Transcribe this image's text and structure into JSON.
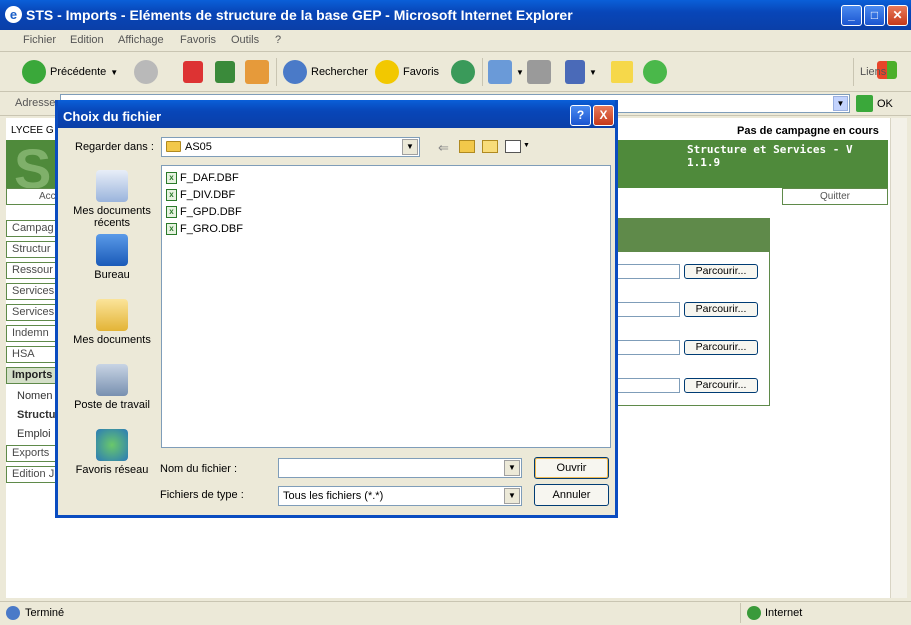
{
  "window": {
    "title": "STS - Imports - Eléments de structure de la base GEP - Microsoft Internet Explorer"
  },
  "menu": [
    "Fichier",
    "Edition",
    "Affichage",
    "Favoris",
    "Outils",
    "?"
  ],
  "toolbar": {
    "back": "Précédente",
    "search": "Rechercher",
    "favorites": "Favoris",
    "links": "Liens"
  },
  "address": {
    "label": "Adresse",
    "go": "OK"
  },
  "page": {
    "school": "LYCEE G",
    "campaign": "Pas de campagne en cours",
    "banner_letter": "S",
    "version": "Structure et Services - V 1.1.9",
    "access_tab": "Acc",
    "quit_tab": "Quitter",
    "nav": [
      "Campag",
      "Structur",
      "Ressour",
      "Services",
      "Services",
      "Indemn",
      "HSA",
      "Imports",
      "Exports",
      "Edition J"
    ],
    "subnav": [
      "Nomen",
      "Structu",
      "Emploi"
    ],
    "browse": [
      "Parcourir...",
      "Parcourir...",
      "Parcourir...",
      "Parcourir..."
    ]
  },
  "dialog": {
    "title": "Choix du fichier",
    "look_in_label": "Regarder dans :",
    "folder": "AS05",
    "places": [
      "Mes documents récents",
      "Bureau",
      "Mes documents",
      "Poste de travail",
      "Favoris réseau"
    ],
    "files": [
      "F_DAF.DBF",
      "F_DIV.DBF",
      "F_GPD.DBF",
      "F_GRO.DBF"
    ],
    "filename_label": "Nom du fichier :",
    "filename_value": "",
    "filetype_label": "Fichiers de type :",
    "filetype_value": "Tous les fichiers (*.*)",
    "open_button": "Ouvrir",
    "cancel_button": "Annuler",
    "help_button": "?",
    "close_button": "X"
  },
  "status": {
    "text": "Terminé",
    "zone": "Internet"
  }
}
